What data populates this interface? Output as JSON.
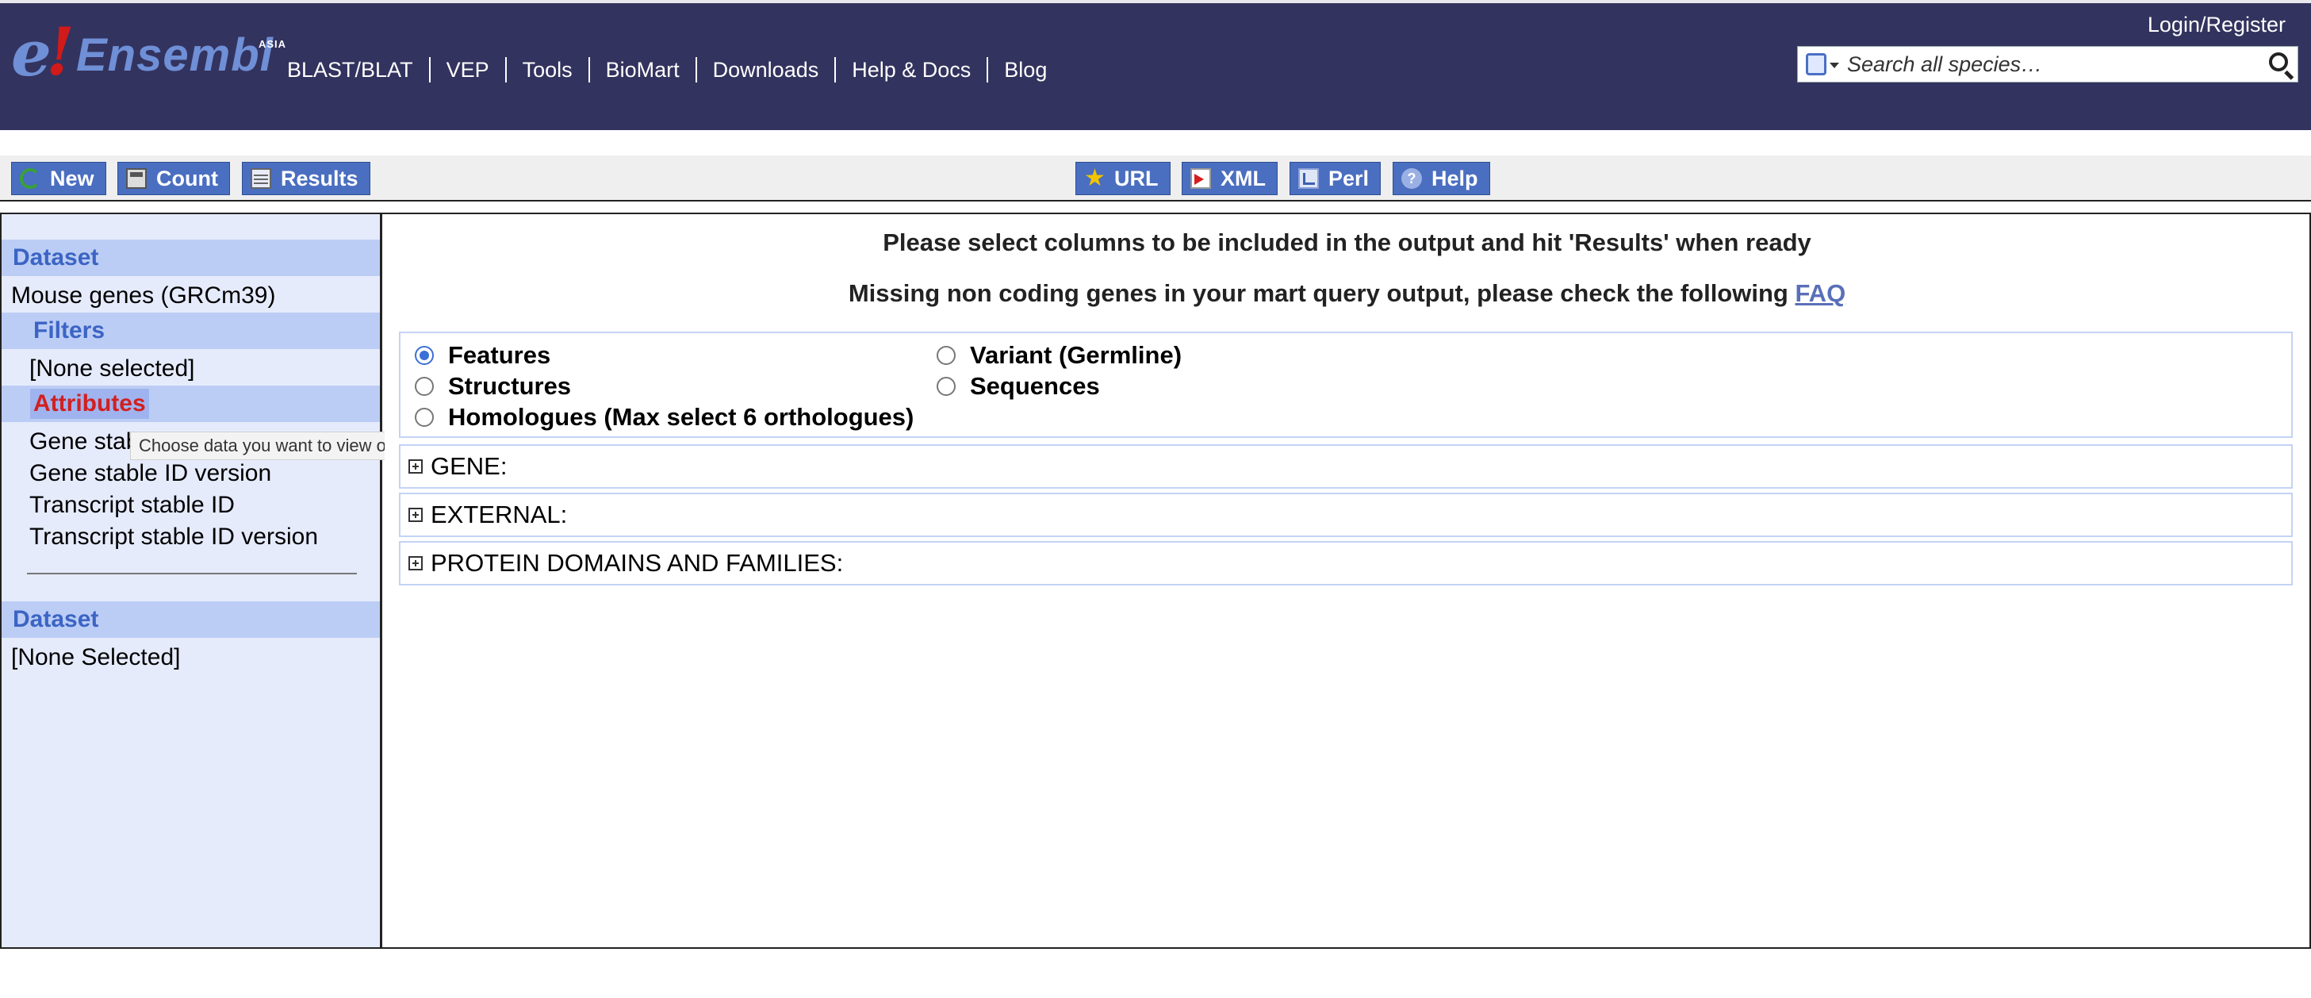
{
  "masthead": {
    "logo_text": "Ensembl",
    "logo_badge": "ASIA",
    "nav": [
      "BLAST/BLAT",
      "VEP",
      "Tools",
      "BioMart",
      "Downloads",
      "Help & Docs",
      "Blog"
    ],
    "login_label": "Login/Register",
    "search": {
      "placeholder": "Search all species…"
    }
  },
  "toolbar": {
    "left_buttons": [
      {
        "label": "New",
        "icon": "refresh-icon"
      },
      {
        "label": "Count",
        "icon": "calculator-icon"
      },
      {
        "label": "Results",
        "icon": "table-icon"
      }
    ],
    "right_buttons": [
      {
        "label": "URL",
        "icon": "star-icon"
      },
      {
        "label": "XML",
        "icon": "xml-icon"
      },
      {
        "label": "Perl",
        "icon": "perl-icon"
      },
      {
        "label": "Help",
        "icon": "help-icon"
      }
    ]
  },
  "sidebar": {
    "dataset_head": "Dataset",
    "dataset_value": "Mouse genes (GRCm39)",
    "filters_head": "Filters",
    "filters_value": "[None selected]",
    "attributes_head": "Attributes",
    "attributes": [
      "Gene stable ID",
      "Gene stable ID version",
      "Transcript stable ID",
      "Transcript stable ID version"
    ],
    "dataset2_head": "Dataset",
    "dataset2_value": "[None Selected]",
    "tooltip": "Choose data you want to view or save"
  },
  "main": {
    "message1": "Please select columns to be included in the output and hit 'Results' when ready",
    "message2_prefix": "Missing non coding genes in your mart query output, please check the following ",
    "message2_link": "FAQ",
    "attribute_pages": [
      {
        "label": "Features",
        "selected": true
      },
      {
        "label": "Variant (Germline)",
        "selected": false
      },
      {
        "label": "Structures",
        "selected": false
      },
      {
        "label": "Sequences",
        "selected": false
      },
      {
        "label": "Homologues (Max select 6 orthologues)",
        "selected": false
      }
    ],
    "sections": [
      "GENE:",
      "EXTERNAL:",
      "PROTEIN DOMAINS AND FAMILIES:"
    ]
  },
  "colors": {
    "masthead_bg": "#33335f",
    "button_bg": "#4a6ec0",
    "sidebar_bg": "#e6ebfc",
    "sidebar_head_bg": "#bccdf5",
    "attributes_head_color": "#d12020"
  }
}
